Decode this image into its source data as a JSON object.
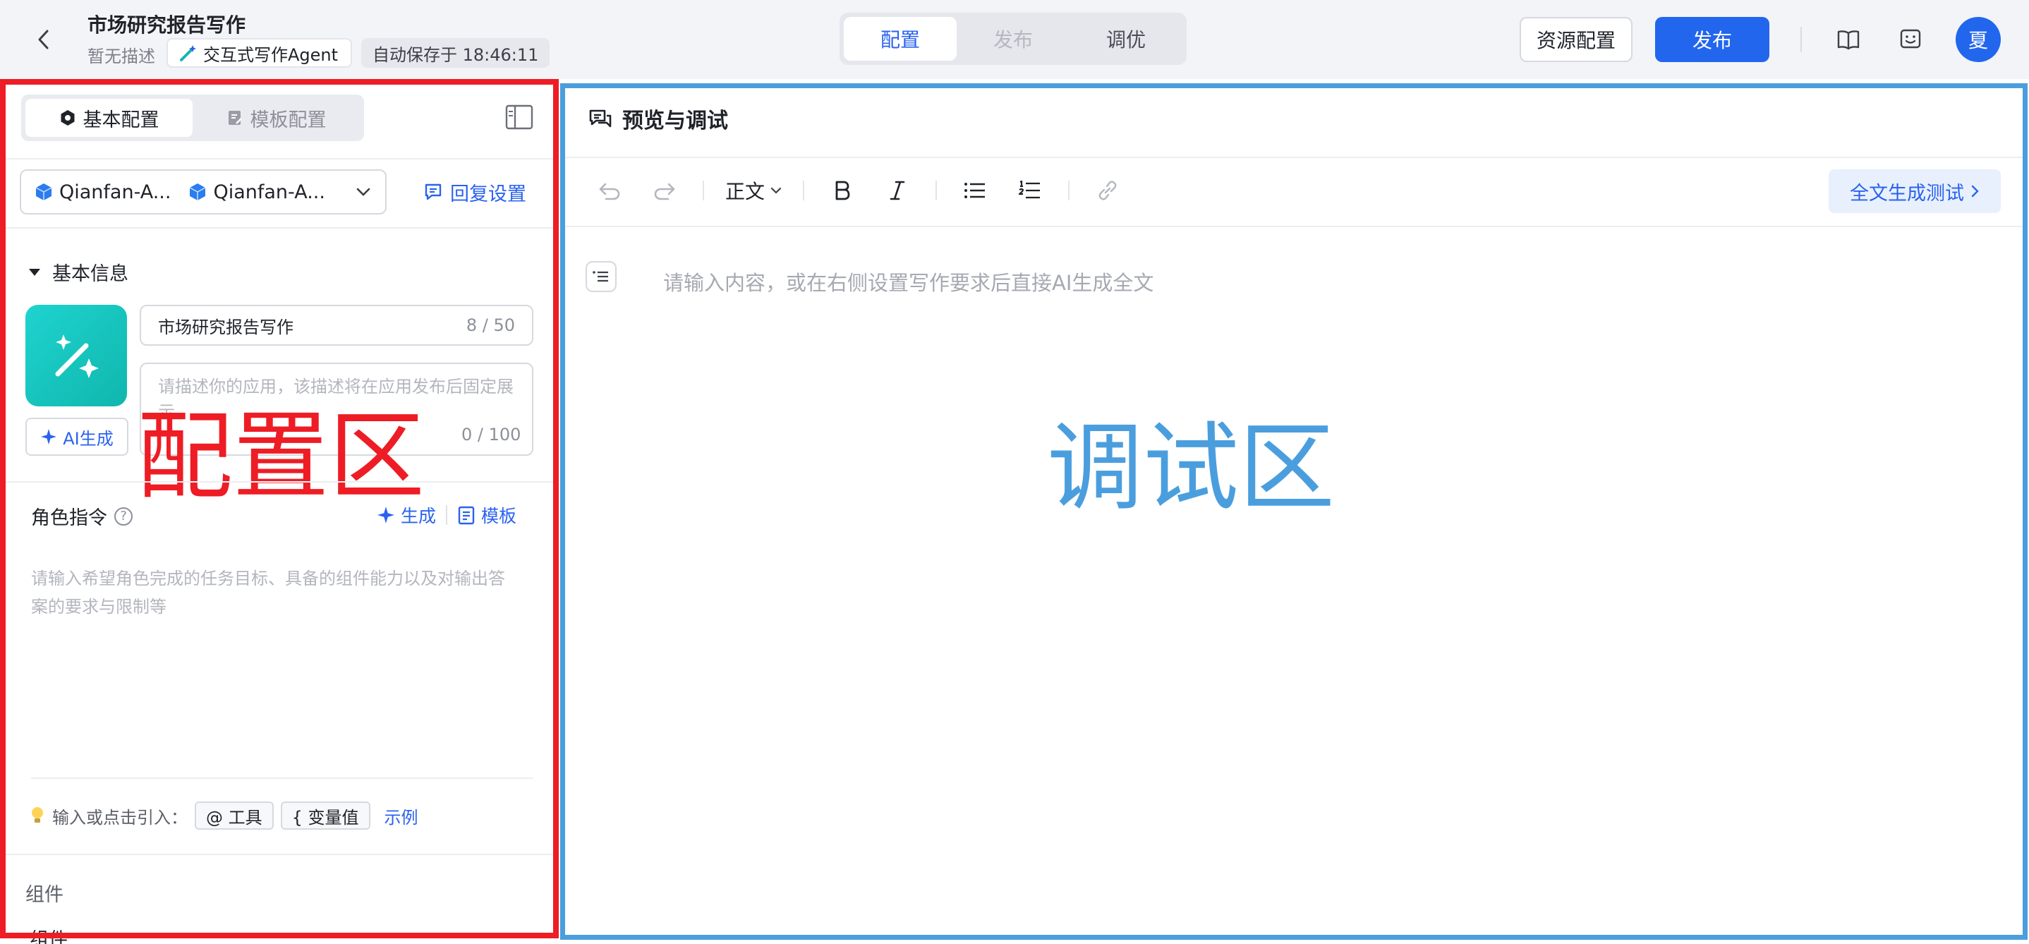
{
  "header": {
    "app_title": "市场研究报告写作",
    "description": "暂无描述",
    "agent_tag": "交互式写作Agent",
    "autosave": "自动保存于 18:46:11",
    "tabs": [
      {
        "label": "配置",
        "active": true
      },
      {
        "label": "发布",
        "active": false
      },
      {
        "label": "调优",
        "active": false
      }
    ],
    "resource_button": "资源配置",
    "publish_button": "发布",
    "avatar_initial": "夏"
  },
  "left": {
    "tabs": [
      {
        "label": "基本配置",
        "active": true
      },
      {
        "label": "模板配置",
        "active": false
      }
    ],
    "models": [
      "Qianfan-A...",
      "Qianfan-A..."
    ],
    "reply_settings": "回复设置",
    "basic_info_title": "基本信息",
    "name_value": "市场研究报告写作",
    "name_counter": "8 / 50",
    "desc_placeholder": "请描述你的应用，该描述将在应用发布后固定展示",
    "desc_counter": "0 / 100",
    "ai_generate": "AI生成",
    "overlay_label": "配置区",
    "role_title": "角色指令",
    "role_generate": "生成",
    "role_template": "模板",
    "role_placeholder": "请输入希望角色完成的任务目标、具备的组件能力以及对输出答案的要求与限制等",
    "hint_label": "输入或点击引入：",
    "chip_tools": "@ 工具",
    "chip_vars": "{ 变量值",
    "example": "示例",
    "components_section": "组件",
    "components_row": "组件"
  },
  "right": {
    "title": "预览与调试",
    "style_select": "正文",
    "generate_test": "全文生成测试",
    "editor_placeholder": "请输入内容，或在右侧设置写作要求后直接AI生成全文",
    "overlay_label": "调试区"
  },
  "colors": {
    "accent": "#2266ee",
    "config_frame": "#ee1c24",
    "debug_frame": "#4a9ede",
    "icon_gradient": [
      "#1fd3cf",
      "#0fb7ad"
    ]
  },
  "icons": [
    "back-chevron-icon",
    "magic-wand-icon",
    "book-icon",
    "feedback-icon",
    "gear-icon",
    "template-icon",
    "panel-collapse-icon",
    "model-cube-icon",
    "chevron-down-icon",
    "message-icon",
    "triangle-down-icon",
    "sparkle-icon",
    "help-icon",
    "bulb-icon",
    "chat-preview-icon",
    "undo-icon",
    "redo-icon",
    "bold-icon",
    "italic-icon",
    "bullet-list-icon",
    "numbered-list-icon",
    "link-icon",
    "chevron-right-icon",
    "outline-icon"
  ]
}
